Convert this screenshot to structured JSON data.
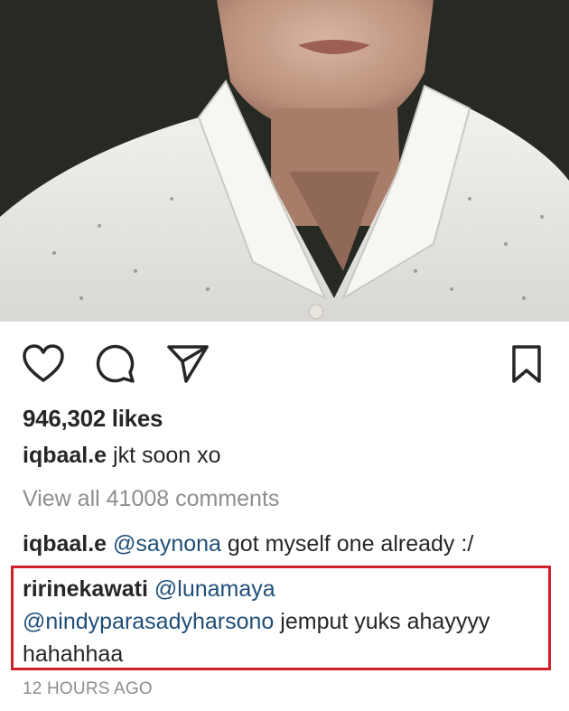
{
  "post": {
    "likes": "946,302 likes",
    "caption": {
      "username": "iqbaal.e",
      "text": " jkt soon xo"
    },
    "view_all_comments": "View all 41008 comments",
    "comments": [
      {
        "username": "iqbaal.e",
        "mention": "@saynona",
        "text": " got myself one already :/"
      },
      {
        "username": "ririnekawati",
        "mention1": "@lunamaya",
        "mention2": "@nindyparasadyharsono",
        "text": " jemput yuks ahayyyy hahahhaa",
        "highlight_color": "#d0212b"
      }
    ],
    "timestamp": "12 HOURS AGO"
  },
  "actions": {
    "like_icon": "heart-icon",
    "comment_icon": "comment-icon",
    "share_icon": "send-icon",
    "save_icon": "bookmark-icon"
  },
  "colors": {
    "mention": "#1f4e79",
    "secondary_text": "#8e8e8e",
    "primary_text": "#262626"
  }
}
